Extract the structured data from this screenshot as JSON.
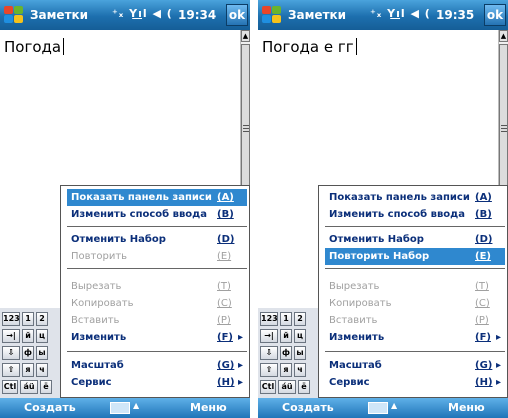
{
  "screens": [
    {
      "title": "Заметки",
      "status_icons": "⁺ₓ Y͟ıl ◀ (",
      "time": "19:34",
      "ok_label": "ok",
      "note_text": "Погода",
      "menu_selected_index": 0,
      "menu": [
        {
          "label": "Показать панель записи",
          "shortcut": "(A)",
          "disabled": false
        },
        {
          "label": "Изменить способ ввода",
          "shortcut": "(B)",
          "disabled": false
        },
        {
          "label": "Отменить Набор",
          "shortcut": "(D)",
          "disabled": false
        },
        {
          "label": "Повторить",
          "shortcut": "(E)",
          "disabled": true
        },
        {
          "label": "Вырезать",
          "shortcut": "(T)",
          "disabled": true
        },
        {
          "label": "Копировать",
          "shortcut": "(C)",
          "disabled": true
        },
        {
          "label": "Вставить",
          "shortcut": "(P)",
          "disabled": true
        },
        {
          "label": "Изменить",
          "shortcut": "(F)",
          "disabled": false,
          "submenu": "▸"
        },
        {
          "label": "Масштаб",
          "shortcut": "(G)",
          "disabled": false,
          "submenu": "▸"
        },
        {
          "label": "Сервис",
          "shortcut": "(H)",
          "disabled": false,
          "submenu": "▸"
        }
      ],
      "softkey_left": "Создать",
      "softkey_right": "Меню",
      "keyboard": {
        "row1": [
          "123",
          "1",
          "2"
        ],
        "row2": [
          "→|",
          "й",
          "ц"
        ],
        "row3": [
          "⇩",
          "ф",
          "ы"
        ],
        "row4": [
          "⇧",
          "я",
          "ч"
        ],
        "row5": [
          "Ctl",
          "áü",
          "ё"
        ]
      }
    },
    {
      "title": "Заметки",
      "status_icons": "⁺ₓ Y͟ıl ◀ (",
      "time": "19:35",
      "ok_label": "ok",
      "note_text": "Погода е гг",
      "menu_selected_index": 3,
      "menu": [
        {
          "label": "Показать панель записи",
          "shortcut": "(A)",
          "disabled": false
        },
        {
          "label": "Изменить способ ввода",
          "shortcut": "(B)",
          "disabled": false
        },
        {
          "label": "Отменить Набор",
          "shortcut": "(D)",
          "disabled": false
        },
        {
          "label": "Повторить Набор",
          "shortcut": "(E)",
          "disabled": false
        },
        {
          "label": "Вырезать",
          "shortcut": "(T)",
          "disabled": true
        },
        {
          "label": "Копировать",
          "shortcut": "(C)",
          "disabled": true
        },
        {
          "label": "Вставить",
          "shortcut": "(P)",
          "disabled": true
        },
        {
          "label": "Изменить",
          "shortcut": "(F)",
          "disabled": false,
          "submenu": "▸"
        },
        {
          "label": "Масштаб",
          "shortcut": "(G)",
          "disabled": false,
          "submenu": "▸"
        },
        {
          "label": "Сервис",
          "shortcut": "(H)",
          "disabled": false,
          "submenu": "▸"
        }
      ],
      "softkey_left": "Создать",
      "softkey_right": "Меню",
      "keyboard": {
        "row1": [
          "123",
          "1",
          "2"
        ],
        "row2": [
          "→|",
          "й",
          "ц"
        ],
        "row3": [
          "⇩",
          "ф",
          "ы"
        ],
        "row4": [
          "⇧",
          "я",
          "ч"
        ],
        "row5": [
          "Ctl",
          "áü",
          "ё"
        ]
      }
    }
  ],
  "colors": {
    "title_bar": "#1d6fae",
    "menu_highlight": "#2f88cf",
    "menu_text": "#0b2f7a",
    "disabled_text": "#a0a0a0"
  }
}
